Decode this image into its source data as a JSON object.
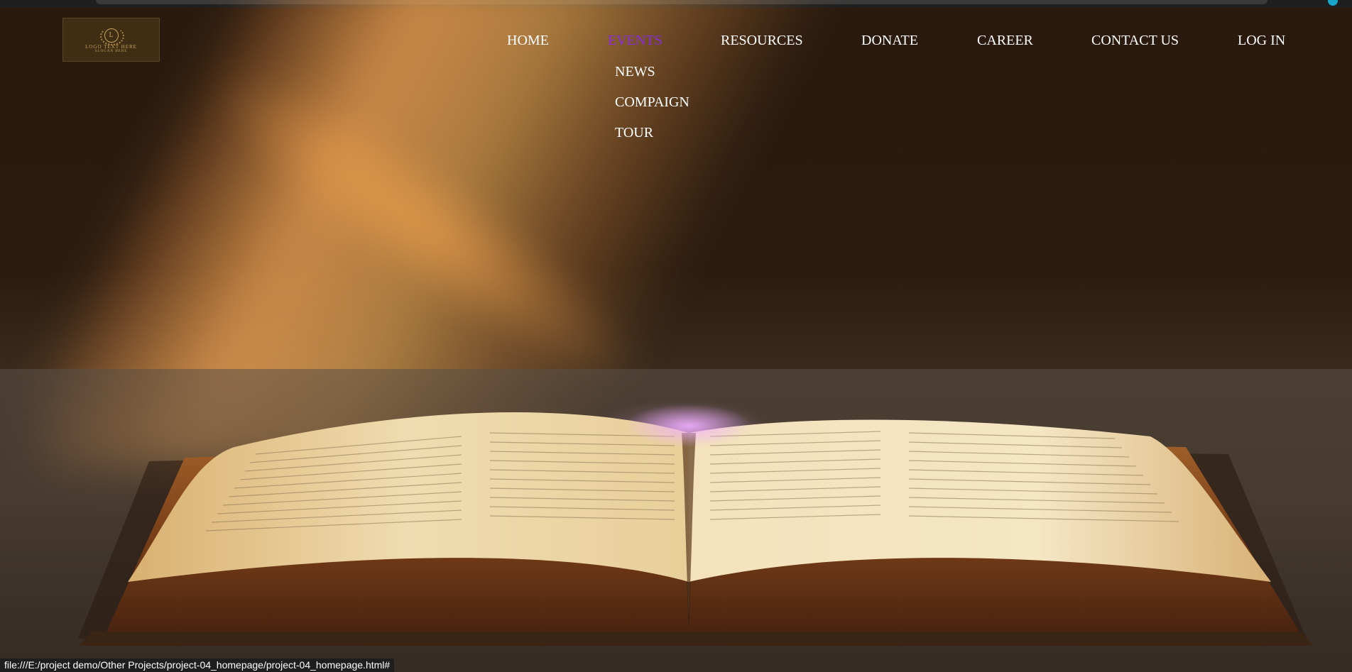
{
  "logo": {
    "emblem_letter": "L",
    "text": "LOGO TEXT HERE",
    "slogan": "SLOGAN HERE"
  },
  "nav": {
    "items": [
      {
        "label": "HOME",
        "active": false
      },
      {
        "label": "EVENTS",
        "active": true
      },
      {
        "label": "RESOURCES",
        "active": false
      },
      {
        "label": "DONATE",
        "active": false
      },
      {
        "label": "CAREER",
        "active": false
      },
      {
        "label": "CONTACT US",
        "active": false
      },
      {
        "label": "LOG IN",
        "active": false
      }
    ],
    "active_color": "#8a2be2",
    "dropdown": [
      "NEWS",
      "COMPAIGN",
      "TOUR"
    ]
  },
  "status_bar": {
    "url": "file:///E:/project demo/Other Projects/project-04_homepage/project-04_homepage.html#"
  },
  "hero": {
    "image": "open-book-with-light-beam"
  }
}
